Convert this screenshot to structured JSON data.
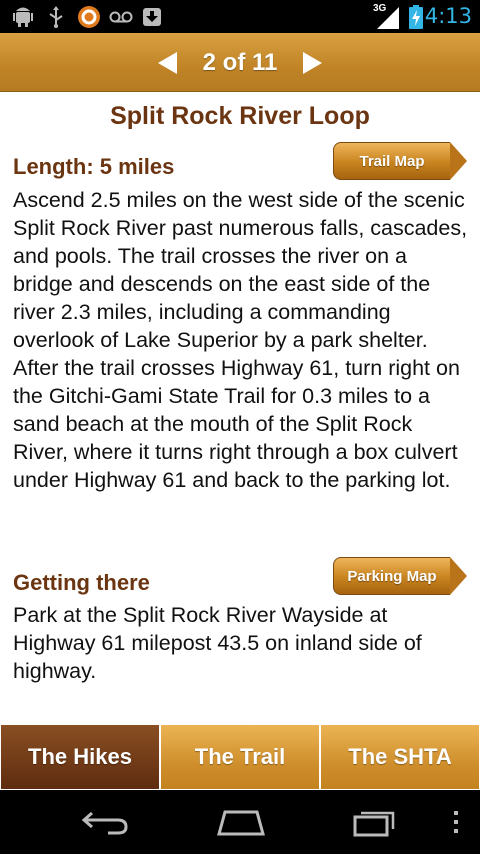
{
  "status_bar": {
    "time": "4:13",
    "network": "3G",
    "icons": [
      "android-debug-icon",
      "usb-icon",
      "sync-icon",
      "voicemail-icon",
      "download-icon",
      "signal-icon",
      "battery-charging-icon"
    ]
  },
  "header": {
    "pager_text": "2 of 11",
    "prev_icon": "arrow-left-icon",
    "next_icon": "arrow-right-icon"
  },
  "content": {
    "title": "Split Rock River Loop",
    "length_heading": "Length: 5 miles",
    "trail_map_button": "Trail Map",
    "description": "Ascend 2.5 miles on the west side of the scenic Split Rock River past numerous falls, cascades, and pools.  The trail crosses the river on a bridge and descends on the east side of the river 2.3 miles,  including a commanding overlook of Lake Superior by a park shelter.  After the trail crosses Highway 61, turn right on the Gitchi-Gami State Trail for 0.3 miles to a sand beach at the mouth of the Split Rock River, where it turns right through a box culvert under Highway 61 and back to the parking lot.",
    "getting_there_heading": "Getting there",
    "parking_map_button": "Parking Map",
    "directions": "Park at the Split Rock River Wayside at Highway 61 milepost 43.5 on inland side of highway."
  },
  "tabs": [
    {
      "label": "The Hikes",
      "active": true
    },
    {
      "label": "The Trail",
      "active": false
    },
    {
      "label": "The SHTA",
      "active": false
    }
  ],
  "nav_bar": {
    "icons": [
      "back-icon",
      "home-icon",
      "recent-apps-icon",
      "menu-icon"
    ]
  },
  "colors": {
    "header_gold": "#c08427",
    "title_brown": "#6b3512",
    "active_tab": "#5e2c10",
    "inactive_tab": "#cf8f2c",
    "clock_blue": "#33b5e5"
  }
}
